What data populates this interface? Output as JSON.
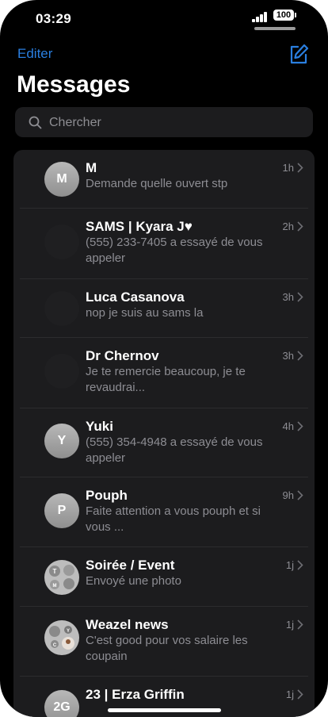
{
  "status_bar": {
    "time": "03:29",
    "battery": "100"
  },
  "nav": {
    "edit_label": "Editer",
    "title": "Messages"
  },
  "search": {
    "placeholder": "Chercher"
  },
  "colors": {
    "accent": "#2a7fe0",
    "background": "#000000",
    "cell": "#1c1c1e",
    "secondary_text": "#8d8d93"
  },
  "icons": {
    "compose": "compose-icon",
    "search": "search-icon",
    "chevron": "chevron-right-icon"
  },
  "conversations": [
    {
      "name": "M",
      "initial": "M",
      "preview": "Demande quelle ouvert stp",
      "time": "1h",
      "avatar": "initial"
    },
    {
      "name": "SAMS | Kyara J♥",
      "initial": "",
      "preview": "(555) 233-7405 a essayé de vous appeler",
      "time": "2h",
      "avatar": "dark"
    },
    {
      "name": "Luca Casanova",
      "initial": "",
      "preview": "nop je suis au sams la",
      "time": "3h",
      "avatar": "dark"
    },
    {
      "name": "Dr Chernov",
      "initial": "",
      "preview": "Je te remercie beaucoup, je te revaudrai...",
      "time": "3h",
      "avatar": "dark"
    },
    {
      "name": "Yuki",
      "initial": "Y",
      "preview": "(555) 354-4948 a essayé de vous appeler",
      "time": "4h",
      "avatar": "initial"
    },
    {
      "name": "Pouph",
      "initial": "P",
      "preview": "Faite attention a vous pouph et si vous ...",
      "time": "9h",
      "avatar": "initial"
    },
    {
      "name": "Soirée / Event",
      "initial": "",
      "preview": "Envoyé une photo",
      "time": "1j",
      "avatar": "group",
      "group_letters": [
        "T",
        "M"
      ]
    },
    {
      "name": "Weazel news",
      "initial": "",
      "preview": "C'est good pour vos salaire les coupain",
      "time": "1j",
      "avatar": "group",
      "group_letters": [
        "Y",
        "C"
      ]
    },
    {
      "name": "23 | Erza Griffin",
      "initial": "2G",
      "preview": "",
      "time": "1j",
      "avatar": "initial"
    }
  ]
}
